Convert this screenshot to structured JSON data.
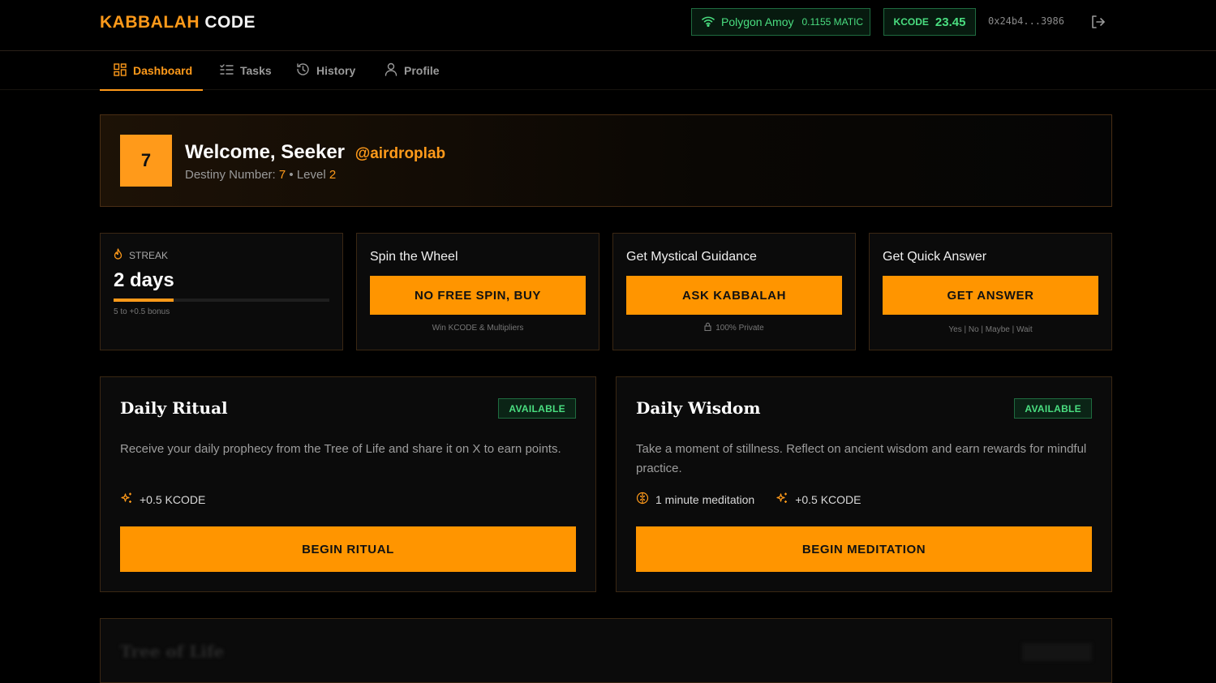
{
  "header": {
    "logo_part1": "KABBALAH",
    "logo_part2": "CODE",
    "network_name": "Polygon Amoy",
    "network_balance": "0.1155 MATIC",
    "kcode_label": "KCODE",
    "kcode_value": "23.45",
    "wallet_address": "0x24b4...3986"
  },
  "tabs": [
    {
      "label": "Dashboard",
      "icon": "dashboard-icon",
      "active": true
    },
    {
      "label": "Tasks",
      "icon": "tasks-icon",
      "active": false
    },
    {
      "label": "History",
      "icon": "history-icon",
      "active": false
    },
    {
      "label": "Profile",
      "icon": "user-icon",
      "active": false
    }
  ],
  "welcome": {
    "destiny_badge": "7",
    "greeting": "Welcome, Seeker",
    "handle": "@airdroplab",
    "destiny_label": "Destiny Number:",
    "destiny_value": "7",
    "level_label": "Level",
    "level_value": "2"
  },
  "streak": {
    "label": "STREAK",
    "value": "2 days",
    "progress_percent": 28,
    "note": "5 to +0.5 bonus"
  },
  "spin": {
    "title": "Spin the Wheel",
    "button": "NO FREE SPIN, BUY",
    "note": "Win KCODE & Multipliers"
  },
  "guidance": {
    "title": "Get Mystical Guidance",
    "button": "ASK KABBALAH",
    "note": "100% Private"
  },
  "quick": {
    "title": "Get Quick Answer",
    "button": "GET ANSWER",
    "note": "Yes | No | Maybe | Wait"
  },
  "ritual": {
    "title": "Daily Ritual",
    "status": "AVAILABLE",
    "description": "Receive your daily prophecy from the Tree of Life and share it on X to earn points.",
    "reward": "+0.5 KCODE",
    "button": "BEGIN RITUAL"
  },
  "wisdom": {
    "title": "Daily Wisdom",
    "status": "AVAILABLE",
    "description": "Take a moment of stillness. Reflect on ancient wisdom and earn rewards for mindful practice.",
    "duration": "1 minute meditation",
    "reward": "+0.5 KCODE",
    "button": "BEGIN MEDITATION"
  },
  "tree": {
    "title": "Tree of Life"
  },
  "colors": {
    "accent": "#ff9500",
    "success": "#4ade80",
    "background": "#000000",
    "card": "#0b0b0b"
  }
}
